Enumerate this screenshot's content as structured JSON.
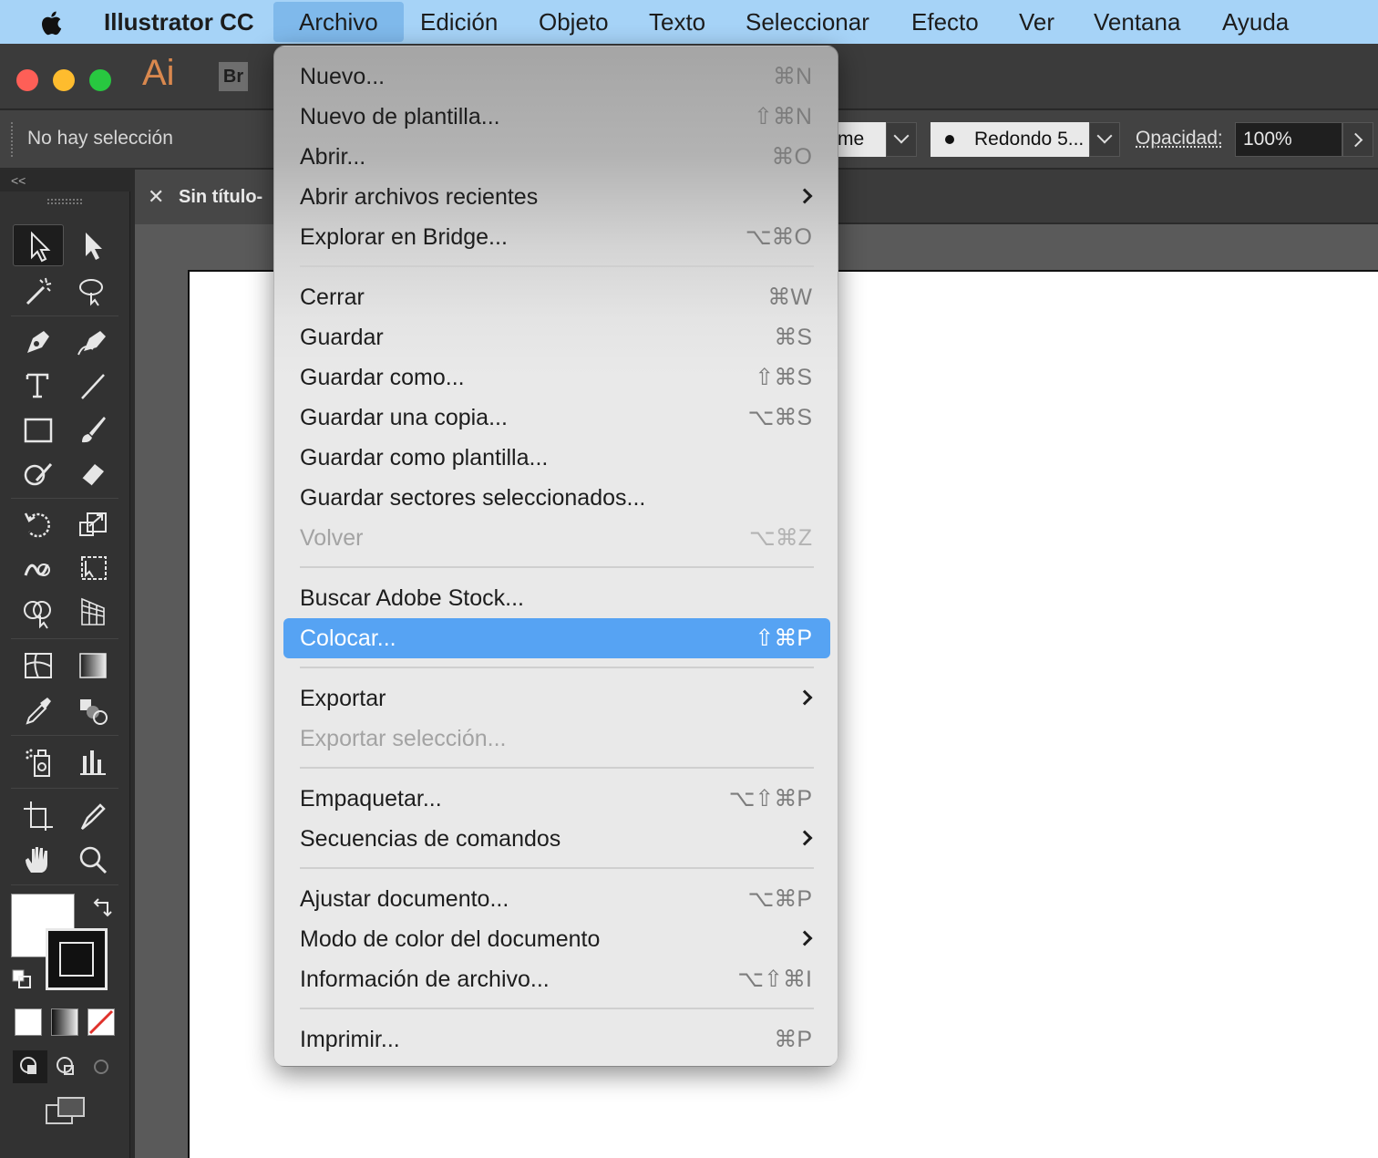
{
  "menubar": {
    "app_name": "Illustrator CC",
    "items": [
      "Archivo",
      "Edición",
      "Objeto",
      "Texto",
      "Seleccionar",
      "Efecto",
      "Ver",
      "Ventana",
      "Ayuda"
    ]
  },
  "window": {
    "app_logo": "Ai",
    "bridge_logo": "Br"
  },
  "control_bar": {
    "selection_status": "No hay selección",
    "profile_value": "rme",
    "brush_value": "Redondo 5...",
    "opacity_label": "Opacidad:",
    "opacity_value": "100%"
  },
  "tools_panel": {
    "collapse_label": "<<"
  },
  "document": {
    "close_glyph": "✕",
    "title": "Sin título-"
  },
  "file_menu": {
    "groups": [
      [
        {
          "label": "Nuevo...",
          "shortcut": "⌘N",
          "submenu": false,
          "disabled": false,
          "highlighted": false
        },
        {
          "label": "Nuevo de plantilla...",
          "shortcut": "⇧⌘N",
          "submenu": false,
          "disabled": false,
          "highlighted": false
        },
        {
          "label": "Abrir...",
          "shortcut": "⌘O",
          "submenu": false,
          "disabled": false,
          "highlighted": false
        },
        {
          "label": "Abrir archivos recientes",
          "shortcut": "",
          "submenu": true,
          "disabled": false,
          "highlighted": false
        },
        {
          "label": "Explorar en Bridge...",
          "shortcut": "⌥⌘O",
          "submenu": false,
          "disabled": false,
          "highlighted": false
        }
      ],
      [
        {
          "label": "Cerrar",
          "shortcut": "⌘W",
          "submenu": false,
          "disabled": false,
          "highlighted": false
        },
        {
          "label": "Guardar",
          "shortcut": "⌘S",
          "submenu": false,
          "disabled": false,
          "highlighted": false
        },
        {
          "label": "Guardar como...",
          "shortcut": "⇧⌘S",
          "submenu": false,
          "disabled": false,
          "highlighted": false
        },
        {
          "label": "Guardar una copia...",
          "shortcut": "⌥⌘S",
          "submenu": false,
          "disabled": false,
          "highlighted": false
        },
        {
          "label": "Guardar como plantilla...",
          "shortcut": "",
          "submenu": false,
          "disabled": false,
          "highlighted": false
        },
        {
          "label": "Guardar sectores seleccionados...",
          "shortcut": "",
          "submenu": false,
          "disabled": false,
          "highlighted": false
        },
        {
          "label": "Volver",
          "shortcut": "⌥⌘Z",
          "submenu": false,
          "disabled": true,
          "highlighted": false
        }
      ],
      [
        {
          "label": "Buscar Adobe Stock...",
          "shortcut": "",
          "submenu": false,
          "disabled": false,
          "highlighted": false
        },
        {
          "label": "Colocar...",
          "shortcut": "⇧⌘P",
          "submenu": false,
          "disabled": false,
          "highlighted": true
        }
      ],
      [
        {
          "label": "Exportar",
          "shortcut": "",
          "submenu": true,
          "disabled": false,
          "highlighted": false
        },
        {
          "label": "Exportar selección...",
          "shortcut": "",
          "submenu": false,
          "disabled": true,
          "highlighted": false
        }
      ],
      [
        {
          "label": "Empaquetar...",
          "shortcut": "⌥⇧⌘P",
          "submenu": false,
          "disabled": false,
          "highlighted": false
        },
        {
          "label": "Secuencias de comandos",
          "shortcut": "",
          "submenu": true,
          "disabled": false,
          "highlighted": false
        }
      ],
      [
        {
          "label": "Ajustar documento...",
          "shortcut": "⌥⌘P",
          "submenu": false,
          "disabled": false,
          "highlighted": false
        },
        {
          "label": "Modo de color del documento",
          "shortcut": "",
          "submenu": true,
          "disabled": false,
          "highlighted": false
        },
        {
          "label": "Información de archivo...",
          "shortcut": "⌥⇧⌘I",
          "submenu": false,
          "disabled": false,
          "highlighted": false
        }
      ],
      [
        {
          "label": "Imprimir...",
          "shortcut": "⌘P",
          "submenu": false,
          "disabled": false,
          "highlighted": false
        }
      ]
    ]
  },
  "colors": {
    "menubar_bg": "#a6d3f7",
    "menu_highlight": "#56a3f3",
    "traffic_red": "#fe5f57",
    "traffic_yellow": "#febc2e",
    "traffic_green": "#28c840",
    "ai_logo": "#d9884e"
  },
  "icons": {
    "tools": [
      "selection-tool-icon",
      "direct-selection-tool-icon",
      "magic-wand-tool-icon",
      "lasso-tool-icon",
      "pen-tool-icon",
      "curvature-tool-icon",
      "type-tool-icon",
      "line-segment-tool-icon",
      "rectangle-tool-icon",
      "paintbrush-tool-icon",
      "shaper-tool-icon",
      "eraser-tool-icon",
      "rotate-tool-icon",
      "scale-tool-icon",
      "warp-tool-icon",
      "free-transform-tool-icon",
      "shape-builder-tool-icon",
      "perspective-grid-tool-icon",
      "mesh-tool-icon",
      "gradient-tool-icon",
      "eyedropper-tool-icon",
      "blend-tool-icon",
      "symbol-sprayer-tool-icon",
      "column-graph-tool-icon",
      "artboard-tool-icon",
      "slice-tool-icon",
      "hand-tool-icon",
      "zoom-tool-icon"
    ]
  }
}
